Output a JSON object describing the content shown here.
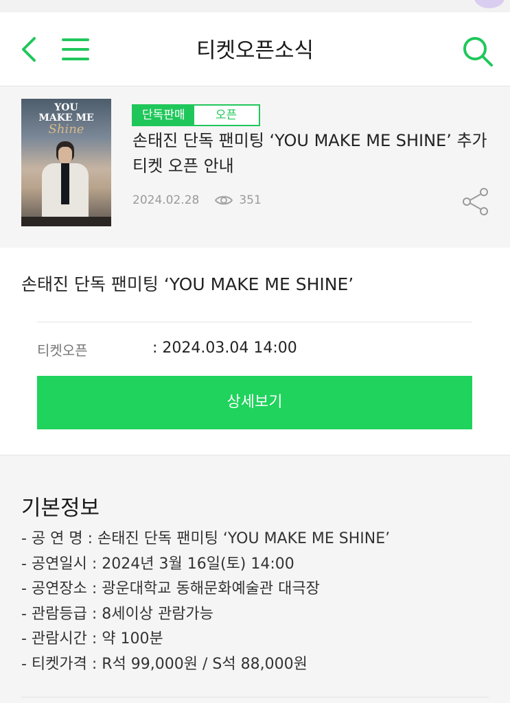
{
  "header": {
    "title": "티켓오픈소식",
    "back_icon": "chevron-left-icon",
    "menu_icon": "hamburger-menu-icon",
    "search_icon": "search-icon",
    "accent_color": "#1fc75a"
  },
  "article": {
    "poster": {
      "title_line1": "YOU",
      "title_line2": "MAKE ME",
      "title_script": "Shine"
    },
    "badge_primary": "단독판매",
    "badge_secondary": "오픈",
    "headline": "손태진 단독 팬미팅 ‘YOU MAKE ME SHINE’ 추가 티켓 오픈 안내",
    "date": "2024.02.28",
    "views": "351",
    "share_icon": "share-icon",
    "views_icon": "eye-icon"
  },
  "ticket": {
    "event_title": "손태진 단독 팬미팅 ‘YOU MAKE ME SHINE’",
    "open_label": "티켓오픈",
    "open_value": ": 2024.03.04 14:00",
    "detail_button": "상세보기",
    "button_color": "#1fd35c"
  },
  "info": {
    "heading": "기본정보",
    "items": [
      "- 공 연 명 : 손태진 단독 팬미팅 ‘YOU MAKE ME SHINE’",
      "- 공연일시 : 2024년 3월 16일(토) 14:00",
      "- 공연장소 : 광운대학교 동해문화예술관 대극장",
      "- 관람등급 : 8세이상 관람가능",
      "- 관람시간 : 약 100분",
      "- 티켓가격 : R석 99,000원 / S석 88,000원"
    ]
  }
}
